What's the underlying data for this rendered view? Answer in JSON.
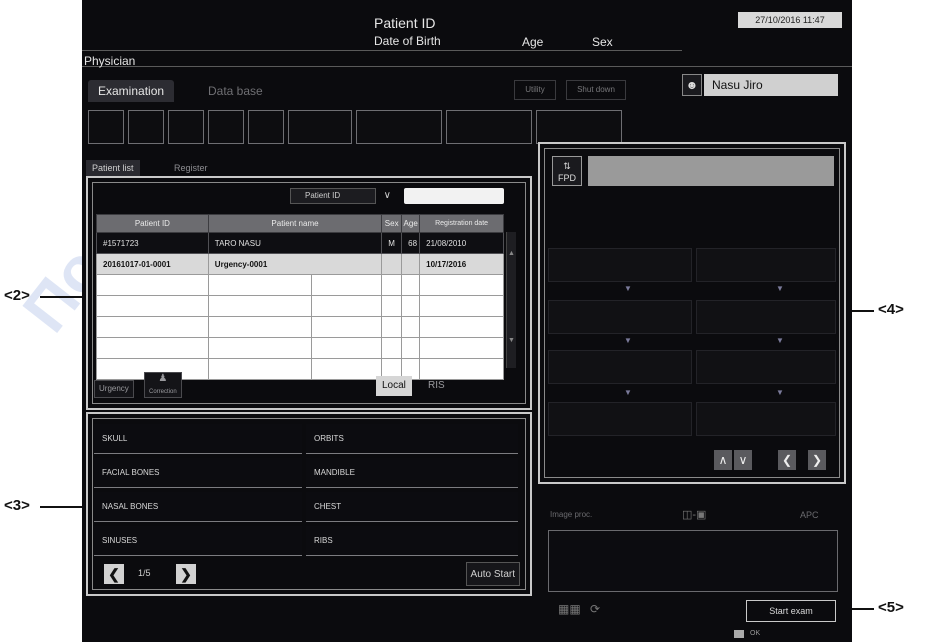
{
  "header": {
    "patient_id_label": "Patient ID",
    "dob_label": "Date of Birth",
    "age_label": "Age",
    "sex_label": "Sex",
    "datetime": "27/10/2016 11:47",
    "physician_label": "Physician"
  },
  "tabs": {
    "examination": "Examination",
    "database": "Data base"
  },
  "toolbar": {
    "utility": "Utility",
    "shutdown": "Shut down"
  },
  "operator": {
    "name": "Nasu Jiro"
  },
  "subtabs": {
    "patient_list": "Patient list",
    "register": "Register"
  },
  "search": {
    "field": "Patient ID"
  },
  "patient_table": {
    "columns": [
      "Patient ID",
      "Patient name",
      "Sex",
      "Age",
      "Registration date"
    ],
    "rows": [
      [
        "#1571723",
        "TARO NASU",
        "M",
        "68",
        "21/08/2010"
      ],
      [
        "20161017-01-0001",
        "Urgency-0001",
        "",
        "",
        "10/17/2016"
      ]
    ]
  },
  "list_buttons": {
    "urgency": "Urgency",
    "correction": "Correction",
    "local": "Local",
    "ris": "RIS"
  },
  "exam_items": {
    "skull": "SKULL",
    "orbits": "ORBITS",
    "facial_bones": "FACIAL BONES",
    "mandible": "MANDIBLE",
    "nasal_bones": "NASAL BONES",
    "chest": "CHEST",
    "sinuses": "SINUSES",
    "ribs": "RIBS"
  },
  "pager": {
    "page": "1/5",
    "auto_start": "Auto Start"
  },
  "detector": {
    "label": "FPD"
  },
  "lower_right": {
    "image_proc": "Image proc.",
    "apc": "APC",
    "start_exam": "Start exam",
    "ok": "OK"
  },
  "callouts": {
    "c2": "<2>",
    "c3": "<3>",
    "c4": "<4>",
    "c5": "<5>"
  },
  "watermark": "Получена с"
}
